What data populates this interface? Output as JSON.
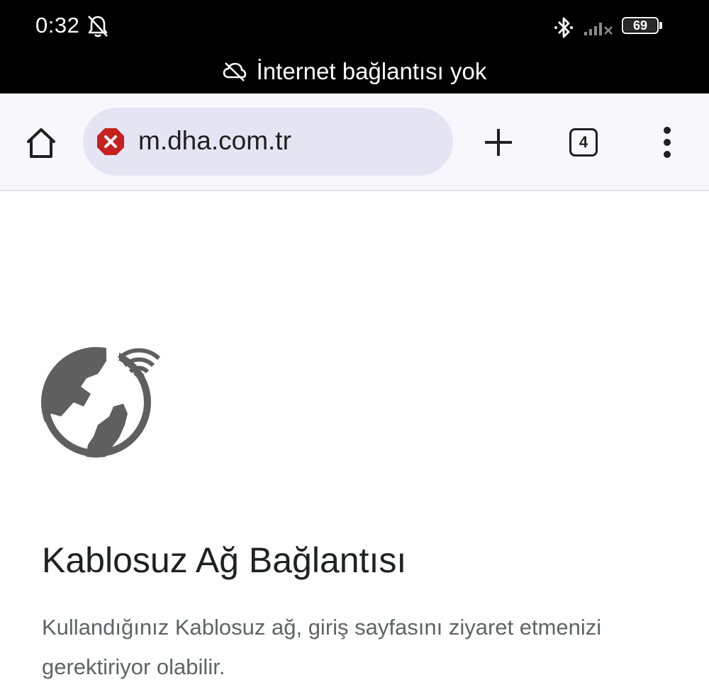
{
  "status_bar": {
    "time": "0:32",
    "battery_level": "69",
    "bell_icon": "bell-off-icon",
    "bluetooth_icon": "bluetooth-icon",
    "signal_icon": "signal-no-service-icon",
    "offline_banner": "İnternet bağlantısı yok",
    "offline_icon": "cloud-off-icon"
  },
  "toolbar": {
    "home_icon": "home-icon",
    "url": "m.dha.com.tr",
    "security_icon": "error-x-icon",
    "new_tab_icon": "plus-icon",
    "tab_count": "4",
    "menu_icon": "more-vert-icon"
  },
  "content": {
    "illustration": "globe-wifi-icon",
    "title": "Kablosuz Ağ Bağlantısı",
    "description": "Kullandığınız Kablosuz ağ, giriş sayfasını ziyaret etmenizi gerektiriyor olabilir."
  },
  "colors": {
    "status_bar_bg": "#000000",
    "toolbar_bg": "#f8f7fc",
    "omnibox_bg": "#e4e4f2",
    "error_red": "#c5221f",
    "icon_gray": "#5f5f5f"
  }
}
